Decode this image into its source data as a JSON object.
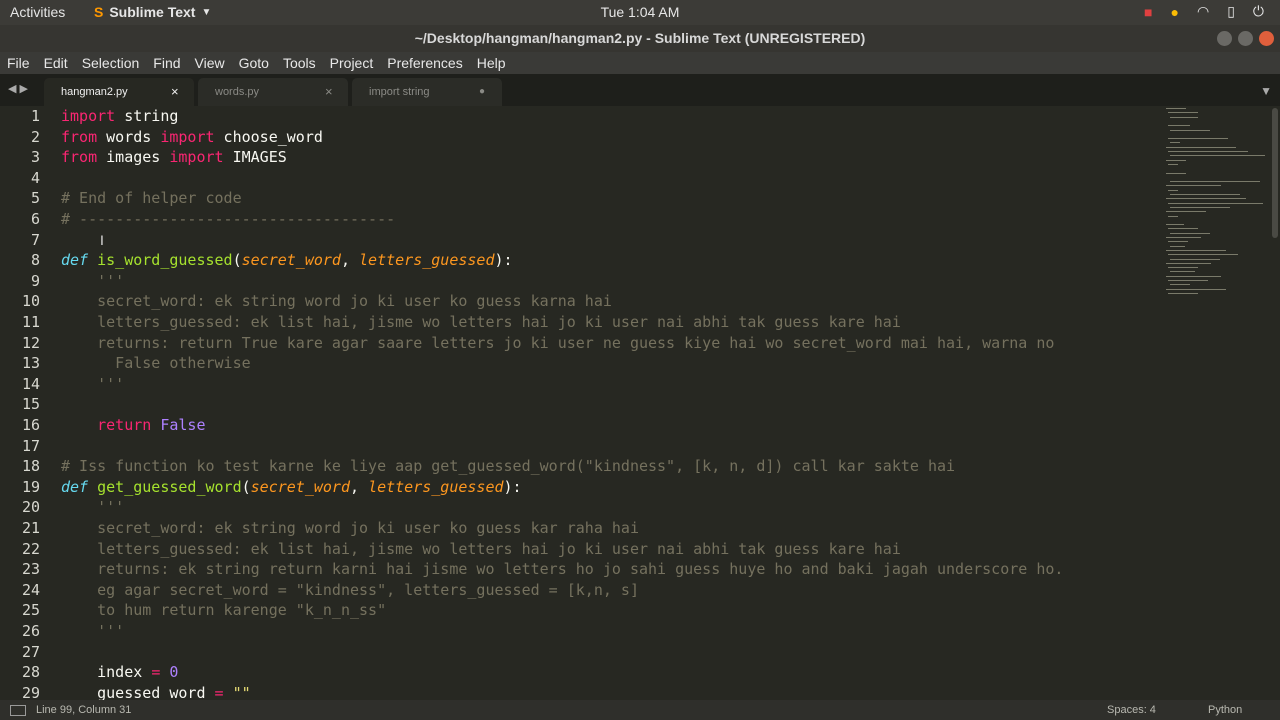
{
  "topbar": {
    "activities": "Activities",
    "app_name": "Sublime Text",
    "clock": "Tue  1:04 AM"
  },
  "window": {
    "title": "~/Desktop/hangman/hangman2.py - Sublime Text (UNREGISTERED)"
  },
  "menu": [
    "File",
    "Edit",
    "Selection",
    "Find",
    "View",
    "Goto",
    "Tools",
    "Project",
    "Preferences",
    "Help"
  ],
  "tabs": [
    {
      "label": "hangman2.py",
      "active": true,
      "status": "×"
    },
    {
      "label": "words.py",
      "active": false,
      "status": "×"
    },
    {
      "label": "import string",
      "active": false,
      "status": "●"
    }
  ],
  "line_numbers": [
    "1",
    "2",
    "3",
    "4",
    "5",
    "6",
    "7",
    "8",
    "9",
    "10",
    "11",
    "12",
    "13",
    "14",
    "15",
    "16",
    "17",
    "18",
    "19",
    "20",
    "21",
    "22",
    "23",
    "24",
    "25",
    "26",
    "27",
    "28",
    "29"
  ],
  "code": {
    "l1": [
      "import",
      " string"
    ],
    "l2": [
      "from",
      " words ",
      "import",
      " choose_word"
    ],
    "l3": [
      "from",
      " images ",
      "import",
      " IMAGES"
    ],
    "l5": "# End of helper code",
    "l6": "# -----------------------------------",
    "l8": [
      "def",
      " ",
      "is_word_guessed",
      "(",
      "secret_word",
      ", ",
      "letters_guessed",
      "):"
    ],
    "l9": "    '''",
    "l10": "    secret_word: ek string word jo ki user ko guess karna hai",
    "l11": "    letters_guessed: ek list hai, jisme wo letters hai jo ki user nai abhi tak guess kare hai",
    "l12": "    returns: return True kare agar saare letters jo ki user ne guess kiye hai wo secret_word mai hai, warna no",
    "l13": "      False otherwise",
    "l14": "    '''",
    "l16": [
      "    ",
      "return",
      " ",
      "False"
    ],
    "l18": "# Iss function ko test karne ke liye aap get_guessed_word(\"kindness\", [k, n, d]) call kar sakte hai",
    "l19": [
      "def",
      " ",
      "get_guessed_word",
      "(",
      "secret_word",
      ", ",
      "letters_guessed",
      "):"
    ],
    "l20": "    '''",
    "l21": "    secret_word: ek string word jo ki user ko guess kar raha hai",
    "l22": "    letters_guessed: ek list hai, jisme wo letters hai jo ki user nai abhi tak guess kare hai",
    "l23": "    returns: ek string return karni hai jisme wo letters ho jo sahi guess huye ho and baki jagah underscore ho.",
    "l24": "    eg agar secret_word = \"kindness\", letters_guessed = [k,n, s]",
    "l25": "    to hum return karenge \"k_n_n_ss\"",
    "l26": "    '''",
    "l28": [
      "    index ",
      "=",
      " ",
      "0"
    ],
    "l29": [
      "    guessed_word ",
      "=",
      " ",
      "\"\""
    ]
  },
  "status": {
    "position": "Line 99, Column 31",
    "spaces": "Spaces: 4",
    "syntax": "Python"
  }
}
